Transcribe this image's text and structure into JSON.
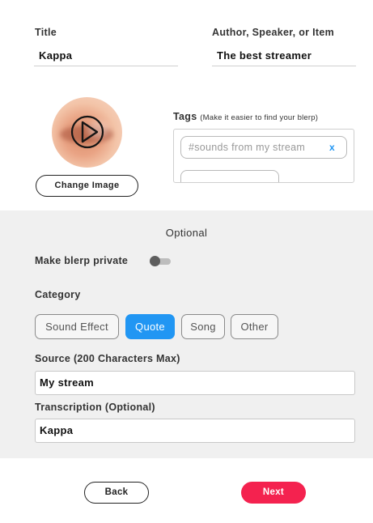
{
  "details": {
    "title_label": "Title",
    "title_value": "Kappa",
    "author_label": "Author, Speaker, or Item",
    "author_value": "The best streamer"
  },
  "image": {
    "change_label": "Change Image",
    "play_icon": "play-icon"
  },
  "tags": {
    "label": "Tags",
    "hint": "(Make it easier to find your blerp)",
    "items": [
      {
        "text": "#sounds from my stream",
        "remove": "x"
      }
    ]
  },
  "optional": {
    "title": "Optional",
    "private_label": "Make blerp private",
    "private_on": false,
    "category_label": "Category",
    "categories": [
      "Sound Effect",
      "Quote",
      "Song",
      "Other"
    ],
    "selected_category": "Quote",
    "source_label": "Source (200 Characters Max)",
    "source_value": "My stream",
    "transcription_label": "Transcription (Optional)",
    "transcription_value": "Kappa"
  },
  "footer": {
    "back_label": "Back",
    "next_label": "Next"
  },
  "colors": {
    "accent_blue": "#2196f3",
    "next_red": "#f4224f",
    "optional_bg": "#f0f0f0"
  }
}
